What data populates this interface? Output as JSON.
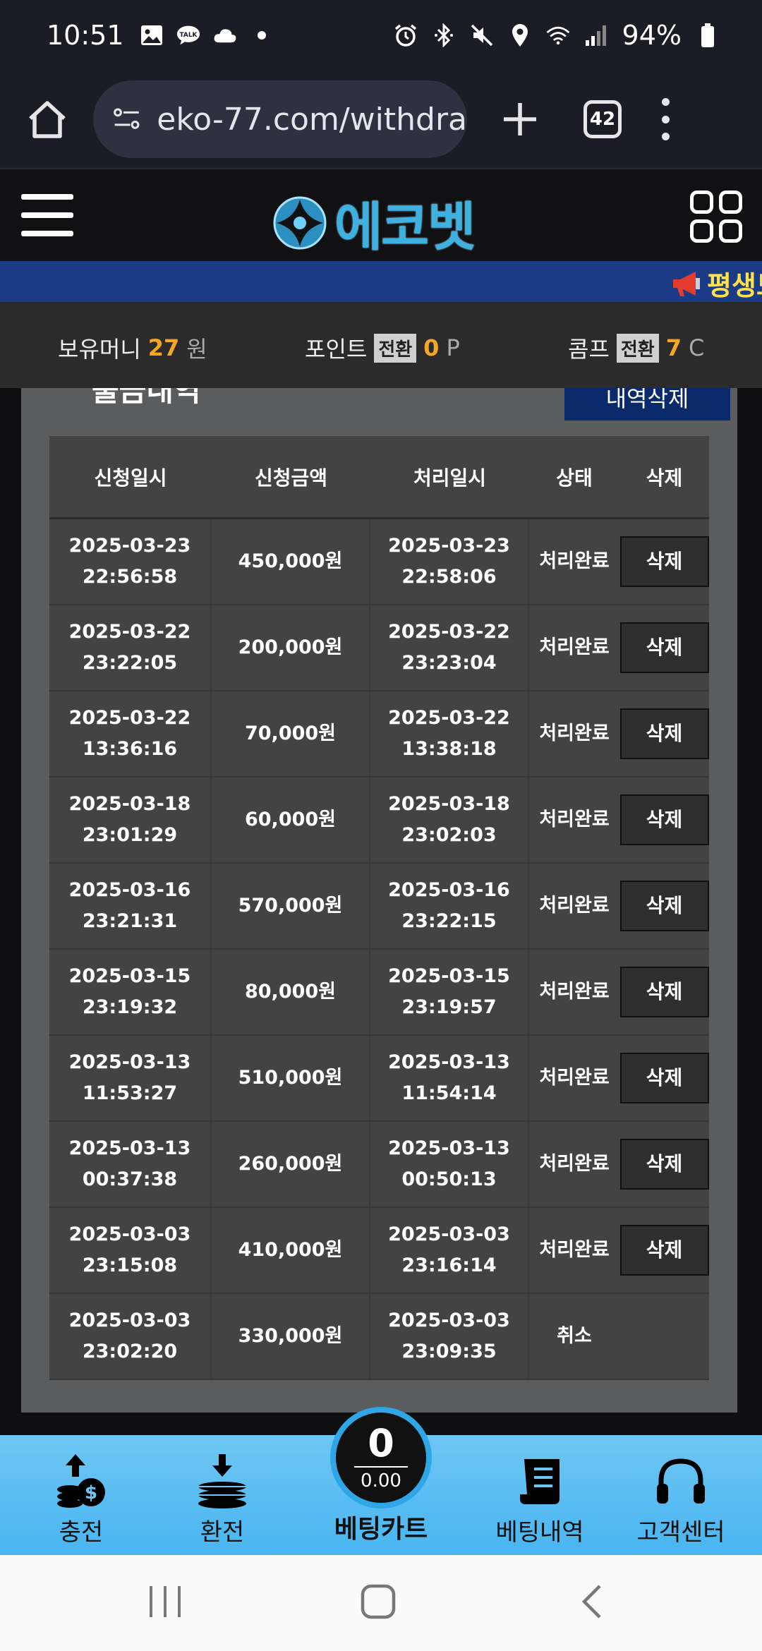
{
  "status_bar": {
    "time": "10:51",
    "battery": "94%",
    "icons_left": [
      "image-icon",
      "talk-icon",
      "cloud-icon",
      "dot-icon"
    ],
    "icons_right": [
      "alarm-icon",
      "bluetooth-icon",
      "mute-icon",
      "location-icon",
      "wifi-icon",
      "signal-icon",
      "battery-icon"
    ]
  },
  "browser": {
    "url": "eko-77.com/withdra",
    "tab_count": "42"
  },
  "site": {
    "logo_text": "에코벳"
  },
  "notice": {
    "text": "평생도"
  },
  "balance": {
    "money_label": "보유머니",
    "money_value": "27",
    "money_unit": "원",
    "point_label": "포인트",
    "point_convert": "전환",
    "point_value": "0",
    "point_unit": "P",
    "comp_label": "콤프",
    "comp_convert": "전환",
    "comp_value": "7",
    "comp_unit": "C"
  },
  "panel": {
    "title": "출금내역",
    "delete_all_label": "내역삭제"
  },
  "table": {
    "headers": [
      "신청일시",
      "신청금액",
      "처리일시",
      "상태",
      "삭제"
    ],
    "rows": [
      {
        "req_date": "2025-03-23",
        "req_time": "22:56:58",
        "amount": "450,000원",
        "proc_date": "2025-03-23",
        "proc_time": "22:58:06",
        "status": "처리완료",
        "delete": "삭제"
      },
      {
        "req_date": "2025-03-22",
        "req_time": "23:22:05",
        "amount": "200,000원",
        "proc_date": "2025-03-22",
        "proc_time": "23:23:04",
        "status": "처리완료",
        "delete": "삭제"
      },
      {
        "req_date": "2025-03-22",
        "req_time": "13:36:16",
        "amount": "70,000원",
        "proc_date": "2025-03-22",
        "proc_time": "13:38:18",
        "status": "처리완료",
        "delete": "삭제"
      },
      {
        "req_date": "2025-03-18",
        "req_time": "23:01:29",
        "amount": "60,000원",
        "proc_date": "2025-03-18",
        "proc_time": "23:02:03",
        "status": "처리완료",
        "delete": "삭제"
      },
      {
        "req_date": "2025-03-16",
        "req_time": "23:21:31",
        "amount": "570,000원",
        "proc_date": "2025-03-16",
        "proc_time": "23:22:15",
        "status": "처리완료",
        "delete": "삭제"
      },
      {
        "req_date": "2025-03-15",
        "req_time": "23:19:32",
        "amount": "80,000원",
        "proc_date": "2025-03-15",
        "proc_time": "23:19:57",
        "status": "처리완료",
        "delete": "삭제"
      },
      {
        "req_date": "2025-03-13",
        "req_time": "11:53:27",
        "amount": "510,000원",
        "proc_date": "2025-03-13",
        "proc_time": "11:54:14",
        "status": "처리완료",
        "delete": "삭제"
      },
      {
        "req_date": "2025-03-13",
        "req_time": "00:37:38",
        "amount": "260,000원",
        "proc_date": "2025-03-13",
        "proc_time": "00:50:13",
        "status": "처리완료",
        "delete": "삭제"
      },
      {
        "req_date": "2025-03-03",
        "req_time": "23:15:08",
        "amount": "410,000원",
        "proc_date": "2025-03-03",
        "proc_time": "23:16:14",
        "status": "처리완료",
        "delete": "삭제"
      },
      {
        "req_date": "2025-03-03",
        "req_time": "23:02:20",
        "amount": "330,000원",
        "proc_date": "2025-03-03",
        "proc_time": "23:09:35",
        "status": "취소",
        "delete": ""
      }
    ]
  },
  "bottom_nav": {
    "deposit": "충전",
    "withdraw": "환전",
    "cart_label": "베팅카트",
    "cart_count": "0",
    "cart_amount": "0.00",
    "bet_history": "베팅내역",
    "support": "고객센터"
  },
  "colors": {
    "accent_orange": "#f5a623",
    "notice_blue": "#1c3b86",
    "nav_blue": "#48b5f0",
    "logo_blue": "#3fb1e0"
  }
}
